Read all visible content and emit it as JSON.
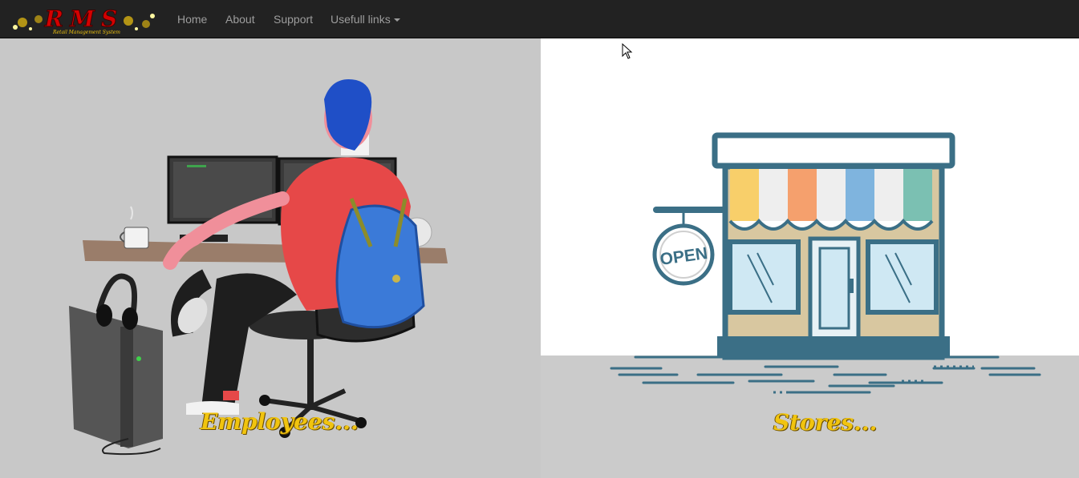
{
  "navbar": {
    "brand": {
      "logo_text": "RMS",
      "tagline": "Retail Management System"
    },
    "items": [
      {
        "label": "Home"
      },
      {
        "label": "About"
      },
      {
        "label": "Support"
      },
      {
        "label": "Usefull links",
        "has_dropdown": true
      }
    ]
  },
  "panels": {
    "employees": {
      "caption": "Employees..."
    },
    "stores": {
      "caption": "Stores...",
      "sign_text": "OPEN"
    }
  },
  "colors": {
    "navbar_bg": "#222222",
    "nav_text": "#9d9d9d",
    "caption": "#f1c40f",
    "store_frame": "#3b6f86"
  }
}
